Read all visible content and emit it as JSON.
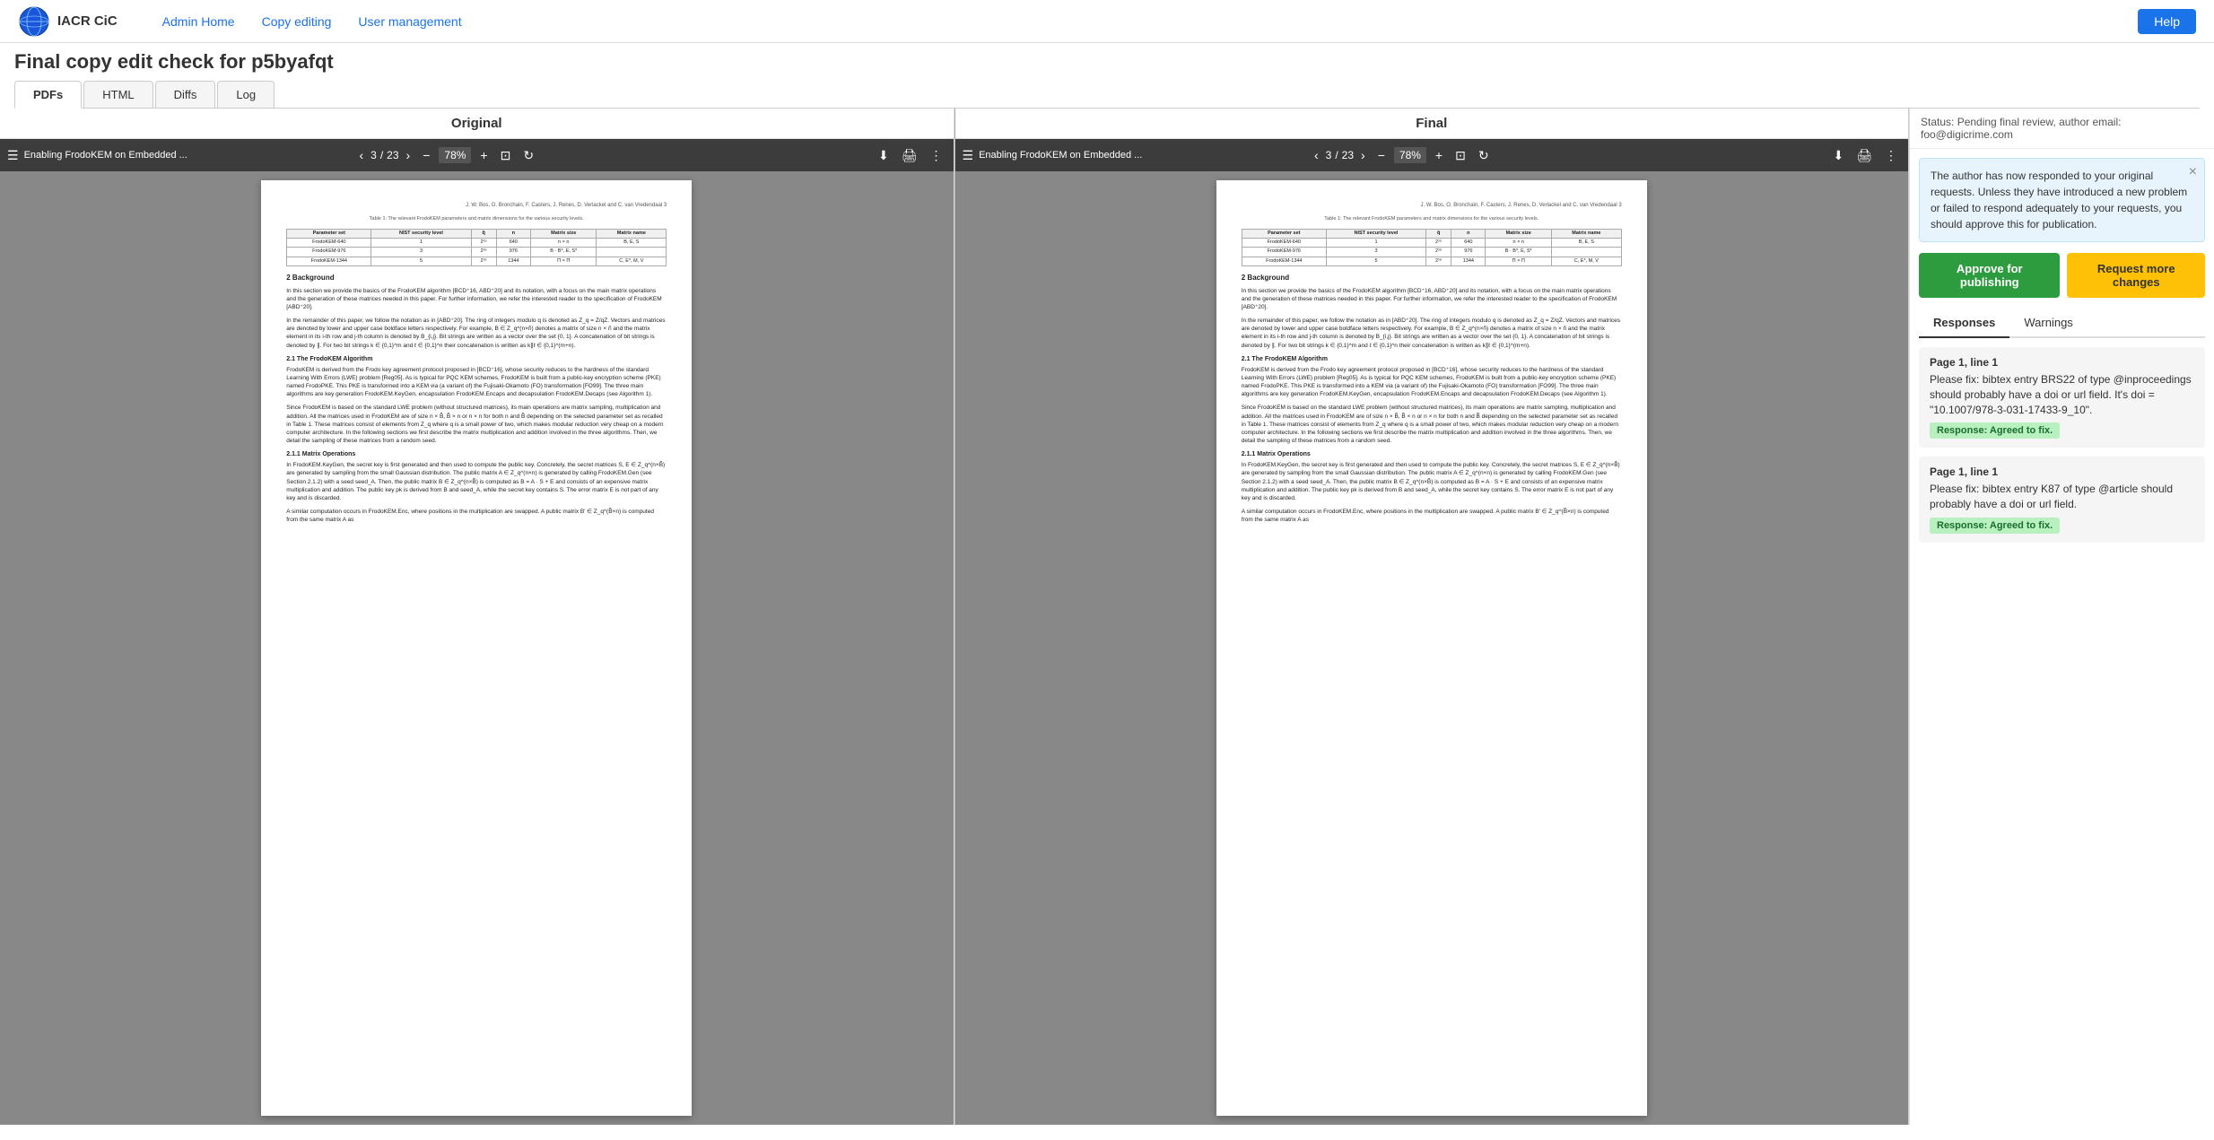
{
  "nav": {
    "brand": "IACR CiC",
    "links": [
      {
        "label": "Admin Home",
        "href": "#"
      },
      {
        "label": "Copy editing",
        "href": "#"
      },
      {
        "label": "User management",
        "href": "#"
      }
    ],
    "help_label": "Help"
  },
  "page": {
    "title": "Final copy edit check for p5byafqt",
    "tabs": [
      {
        "label": "PDFs",
        "active": true
      },
      {
        "label": "HTML",
        "active": false
      },
      {
        "label": "Diffs",
        "active": false
      },
      {
        "label": "Log",
        "active": false
      }
    ]
  },
  "panels": [
    {
      "header": "Original",
      "toolbar": {
        "menu_icon": "☰",
        "title": "Enabling FrodoKEM on Embedded ...",
        "page_current": "3",
        "page_total": "23",
        "zoom": "78%",
        "icons": [
          "+",
          "−"
        ]
      }
    },
    {
      "header": "Final",
      "toolbar": {
        "menu_icon": "☰",
        "title": "Enabling FrodoKEM on Embedded ...",
        "page_current": "3",
        "page_total": "23",
        "zoom": "78%",
        "icons": [
          "+",
          "−"
        ]
      }
    }
  ],
  "pdf_content": {
    "authors": "J. W. Bos, O. Bronchain, F. Casters, J. Renes, D. Verlackel and C. van Vredendaal   3",
    "table_caption": "Table 1: The relevant FrodoKEM parameters and matrix dimensions for the various security levels.",
    "table_headers": [
      "Parameter set",
      "NIST security level",
      "q̃",
      "n",
      "Matrix size",
      "Matrix name"
    ],
    "table_rows": [
      [
        "FrodoKEM-640",
        "1",
        "2¹⁵",
        "640",
        "n × n",
        "B, E, S"
      ],
      [
        "FrodoKEM-976",
        "3",
        "2¹⁶",
        "976",
        "B · B*, E, S*",
        ""
      ],
      [
        "FrodoKEM-1344",
        "5",
        "2¹⁶",
        "1344",
        "Π × Π",
        "C, E*, M, V"
      ]
    ],
    "sections": [
      {
        "heading": "2   Background",
        "text": "In this section we provide the basics of the FrodoKEM algorithm [BCD⁺16, ABD⁺20] and its notation, with a focus on the main matrix operations and the generation of these matrices needed in this paper. For further information, we refer the interested reader to the specification of FrodoKEM [ABD⁺20].\n\nIn the remainder of this paper, we follow the notation as in [ABD⁺20]. The ring of integers modulo q is denoted as Zq = Z/qZ. Vectors and matrices are denoted by lower and upper case boldface letters respectively. For example, B ∈ Zq^n×ñ denotes a matrix of size n × ñ and the matrix element in its i-th row and j-th column is denoted by Bi,j. Bit strings are written as a vector over the set {0, 1}. A concatenation of bit strings is denoted by ∥. For two bit strings k ∈ {0,1}^m and ℓ ∈ {0,1}^n their concatenation is written as k∥ℓ ∈ {0,1}^(m+n)."
      },
      {
        "heading": "2.1   The FrodoKEM Algorithm",
        "text": "FrodoKEM is derived from the Frodo key agreement protocol proposed in [BCD⁺16], whose security reduces to the hardness of the standard Learning With Errors (LWE) problem [Reg05]. As is typical for PQC KEM schemes, FrodoKEM is built from a public-key encryption scheme (PKE) named FrodoPKE. This PKE is transformed into a KEM via (a variant of) the Fujisaki-Okamoto (FO) transformation [FO99]. The three main algorithms are key generation FrodoKEM.KeyGen, encapsulation FrodoKEM.Encaps and decapsulation FrodoKEM.Decaps (see Algorithm 1).\n\nSince FrodoKEM is based on the standard LWE problem (without structured matrices), its main operations are matrix sampling, multiplication and addition. All the matrices used in FrodoKEM are of size n × B̃, B̃ × n or n × n for both n and B̃ depending on the selected parameter set as recalled in Table 1. These matrices consist of elements from Zq where q is a small power of two, which makes modular reduction very cheap on a modern computer architecture. In the following sections we first describe the matrix multiplication and addition involved in the three algorithms. Then, we detail the sampling of these matrices from a random seed."
      },
      {
        "heading": "2.1.1   Matrix Operations",
        "text": "In FrodoKEM.KeyGen, the secret key is first generated and then used to compute the public key. Concretely, the secret matrices S, E ∈ Zq^n×B̃ are generated by sampling from the small Gaussian distribution. The public matrix A ∈ Zq^n×n is generated by calling FrodoKEM.Gen (see Section 2.1.2) with a seed seedA. Then, the public matrix B ∈ Zq^n×B̃ is computed as B = A · S + E and consists of an expensive matrix multiplication and addition. The public key pk is derived from B and seedA, while the secret key contains S. The error matrix E is not part of any key and is discarded.\n\nA similar computation occurs in FrodoKEM.Enc, where positions in the multiplication are swapped. A public matrix B' ∈ Zq^B̃×n is computed from the same matrix A as"
      }
    ]
  },
  "sidebar": {
    "status": "Status: Pending final review, author email: foo@digicrime.com",
    "notice": "The author has now responded to your original requests. Unless they have introduced a new problem or failed to respond adequately to your requests, you should approve this for publication.",
    "approve_label": "Approve for publishing",
    "request_label": "Request more changes",
    "tabs": [
      {
        "label": "Responses",
        "active": true
      },
      {
        "label": "Warnings",
        "active": false
      }
    ],
    "responses": [
      {
        "location": "Page 1, line 1",
        "text": "Please fix: bibtex entry BRS22 of type @inproceedings should probably have a doi or url field. It's doi = \"10.1007/978-3-031-17433-9_10\".",
        "response": "Response: Agreed to fix."
      },
      {
        "location": "Page 1, line 1",
        "text": "Please fix: bibtex entry K87 of type @article should probably have a doi or url field.",
        "response": "Response: Agreed to fix."
      }
    ]
  }
}
